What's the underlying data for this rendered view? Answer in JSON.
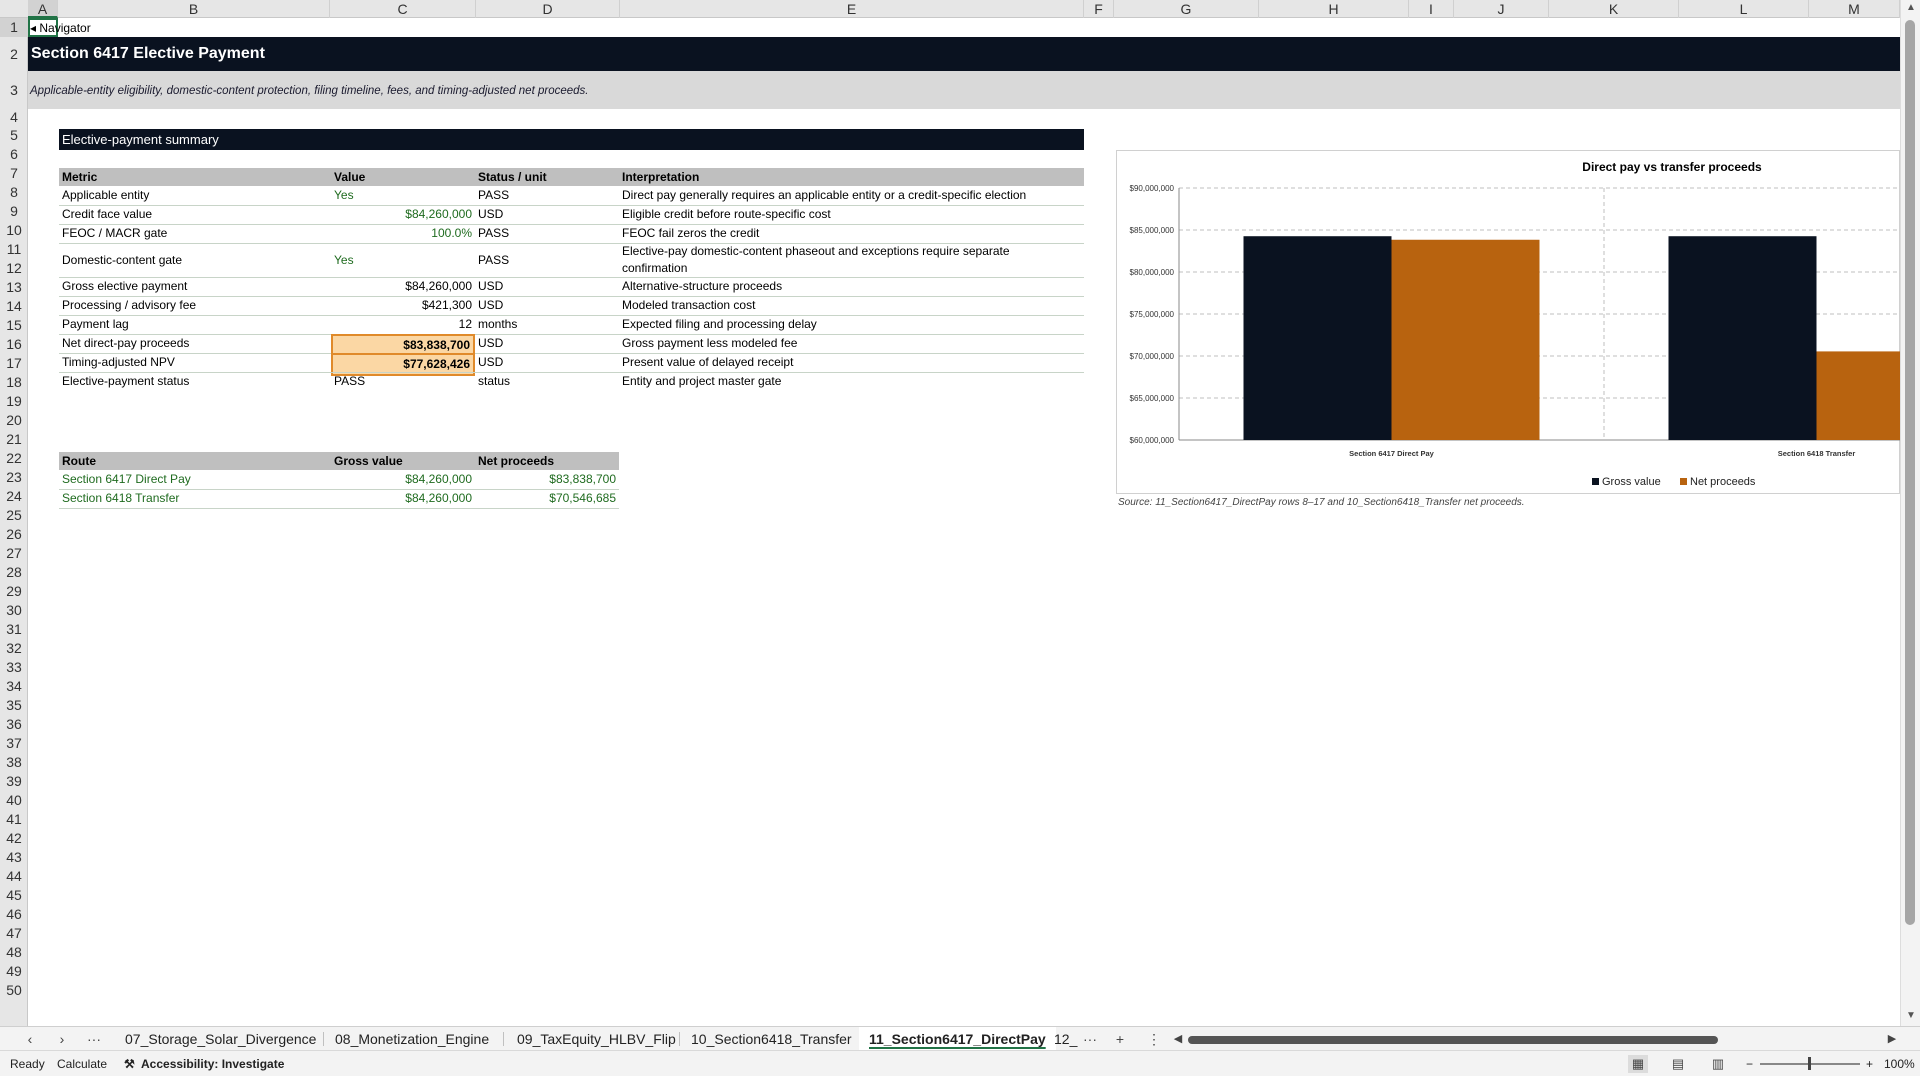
{
  "columns": [
    "A",
    "B",
    "C",
    "D",
    "E",
    "F",
    "G",
    "H",
    "I",
    "J",
    "K",
    "L",
    "M"
  ],
  "rows": [
    "1",
    "2",
    "3",
    "4",
    "5",
    "6",
    "7",
    "8",
    "9",
    "10",
    "11",
    "12",
    "13",
    "14",
    "15",
    "16",
    "17",
    "18",
    "19",
    "20",
    "21",
    "22",
    "23",
    "24",
    "25",
    "26",
    "27",
    "28",
    "29",
    "30",
    "31",
    "32",
    "33",
    "34",
    "35",
    "36",
    "37",
    "38",
    "39",
    "40",
    "41",
    "42",
    "43",
    "44",
    "45",
    "46",
    "47",
    "48",
    "49",
    "50"
  ],
  "navigator": "◂ Navigator",
  "title": "Section 6417 Elective Payment",
  "subtitle": "Applicable-entity eligibility, domestic-content protection, filing timeline, fees, and timing-adjusted net proceeds.",
  "summary_header": "Elective-payment summary",
  "summary_table": {
    "headers": [
      "Metric",
      "Value",
      "Status / unit",
      "Interpretation"
    ],
    "rows": [
      {
        "metric": "Applicable entity",
        "value": "Yes",
        "unit": "PASS",
        "interp": "Direct pay generally requires an applicable entity or a credit-specific election"
      },
      {
        "metric": "Credit face value",
        "value": "$84,260,000",
        "unit": "USD",
        "interp": "Eligible credit before route-specific cost"
      },
      {
        "metric": "FEOC / MACR gate",
        "value": "100.0%",
        "unit": "PASS",
        "interp": "FEOC fail zeros the credit"
      },
      {
        "metric": "Domestic-content gate",
        "value": "Yes",
        "unit": "PASS",
        "interp": "Elective-pay domestic-content phaseout and exceptions require separate",
        "interp2": "confirmation"
      },
      {
        "metric": "Gross elective payment",
        "value": "$84,260,000",
        "unit": "USD",
        "interp": "Alternative-structure proceeds"
      },
      {
        "metric": "Processing / advisory fee",
        "value": "$421,300",
        "unit": "USD",
        "interp": "Modeled transaction cost"
      },
      {
        "metric": "Payment lag",
        "value": "12",
        "unit": "months",
        "interp": "Expected filing and processing delay"
      },
      {
        "metric": "Net direct-pay proceeds",
        "value": "$83,838,700",
        "unit": "USD",
        "interp": "Gross payment less modeled fee"
      },
      {
        "metric": "Timing-adjusted NPV",
        "value": "$77,628,426",
        "unit": "USD",
        "interp": "Present value of delayed receipt"
      },
      {
        "metric": "Elective-payment status",
        "value": "PASS",
        "unit": "status",
        "interp": "Entity and project master gate"
      }
    ]
  },
  "route_table": {
    "headers": [
      "Route",
      "Gross value",
      "Net proceeds"
    ],
    "rows": [
      {
        "route": "Section 6417 Direct Pay",
        "gross": "$84,260,000",
        "net": "$83,838,700"
      },
      {
        "route": "Section 6418 Transfer",
        "gross": "$84,260,000",
        "net": "$70,546,685"
      }
    ]
  },
  "chart_data": {
    "type": "bar",
    "title": "Direct pay vs transfer proceeds",
    "categories": [
      "Section 6417 Direct Pay",
      "Section 6418 Transfer"
    ],
    "series": [
      {
        "name": "Gross value",
        "values": [
          84260000,
          84260000
        ],
        "color": "#0a1220"
      },
      {
        "name": "Net proceeds",
        "values": [
          83838700,
          70546685
        ],
        "color": "#b8630f"
      }
    ],
    "ylim": [
      60000000,
      90000000
    ],
    "yticks": [
      "$60,000,000",
      "$65,000,000",
      "$70,000,000",
      "$75,000,000",
      "$80,000,000",
      "$85,000,000",
      "$90,000,000"
    ],
    "ytick_values": [
      60000000,
      65000000,
      70000000,
      75000000,
      80000000,
      85000000,
      90000000
    ],
    "legend_position": "bottom",
    "grid": true
  },
  "chart_source": "Source: 11_Section6417_DirectPay rows 8–17 and 10_Section6418_Transfer net proceeds.",
  "tabs": [
    "07_Storage_Solar_Divergence",
    "08_Monetization_Engine",
    "09_TaxEquity_HLBV_Flip",
    "10_Section6418_Transfer",
    "11_Section6417_DirectPay",
    "12_"
  ],
  "active_tab": "11_Section6417_DirectPay",
  "status": {
    "ready": "Ready",
    "calculate": "Calculate",
    "accessibility": "Accessibility: Investigate",
    "zoom": "100%"
  }
}
